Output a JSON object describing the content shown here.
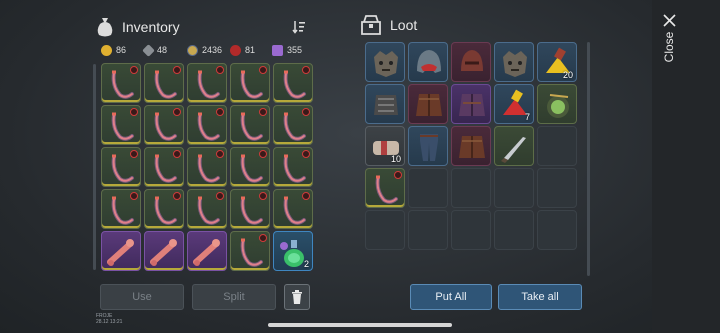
{
  "inventory": {
    "title": "Inventory",
    "icon": "sack-icon",
    "sort_icon": "sort-icon",
    "currencies": [
      {
        "icon": "gold-coin-icon",
        "color": "#e0b030",
        "value": "86"
      },
      {
        "icon": "gem-icon",
        "color": "#8a8f94",
        "value": "48"
      },
      {
        "icon": "silver-coin-icon",
        "color": "#c8a850",
        "value": "2436"
      },
      {
        "icon": "red-token-icon",
        "color": "#b22a2a",
        "value": "81"
      },
      {
        "icon": "purple-shard-icon",
        "color": "#9a6ad0",
        "value": "355"
      }
    ],
    "slots": [
      {
        "item": "horn"
      },
      {
        "item": "horn"
      },
      {
        "item": "horn"
      },
      {
        "item": "horn"
      },
      {
        "item": "horn"
      },
      {
        "item": "horn"
      },
      {
        "item": "horn"
      },
      {
        "item": "horn"
      },
      {
        "item": "horn"
      },
      {
        "item": "horn"
      },
      {
        "item": "horn"
      },
      {
        "item": "horn"
      },
      {
        "item": "horn"
      },
      {
        "item": "horn"
      },
      {
        "item": "horn"
      },
      {
        "item": "horn"
      },
      {
        "item": "horn"
      },
      {
        "item": "horn"
      },
      {
        "item": "horn"
      },
      {
        "item": "horn"
      },
      {
        "item": "bone"
      },
      {
        "item": "bone"
      },
      {
        "item": "bone"
      },
      {
        "item": "horn"
      },
      {
        "item": "potion",
        "qty": "2"
      }
    ],
    "buttons": {
      "use": "Use",
      "split": "Split",
      "delete_icon": "trash-icon"
    }
  },
  "loot": {
    "title": "Loot",
    "icon": "chest-icon",
    "slots": [
      {
        "item": "wolf-helmet"
      },
      {
        "item": "hood"
      },
      {
        "item": "red-helmet"
      },
      {
        "item": "wolf-helmet"
      },
      {
        "item": "yellow-powder",
        "qty": "20"
      },
      {
        "item": "chest-armor"
      },
      {
        "item": "leather-jacket"
      },
      {
        "item": "violet-jacket"
      },
      {
        "item": "red-powder",
        "qty": "7"
      },
      {
        "item": "green-orb"
      },
      {
        "item": "bandage",
        "qty": "10"
      },
      {
        "item": "pants"
      },
      {
        "item": "leather-jacket"
      },
      {
        "item": "knife"
      },
      {
        "item": ""
      },
      {
        "item": "horn"
      },
      {
        "item": ""
      },
      {
        "item": ""
      },
      {
        "item": ""
      },
      {
        "item": ""
      },
      {
        "item": ""
      },
      {
        "item": ""
      },
      {
        "item": ""
      },
      {
        "item": ""
      },
      {
        "item": ""
      }
    ],
    "buttons": {
      "put_all": "Put All",
      "take_all": "Take all"
    }
  },
  "close": {
    "label": "Close",
    "icon": "close-icon"
  },
  "footer": {
    "line1": "FROJE",
    "line2": "28.12 13:21"
  }
}
